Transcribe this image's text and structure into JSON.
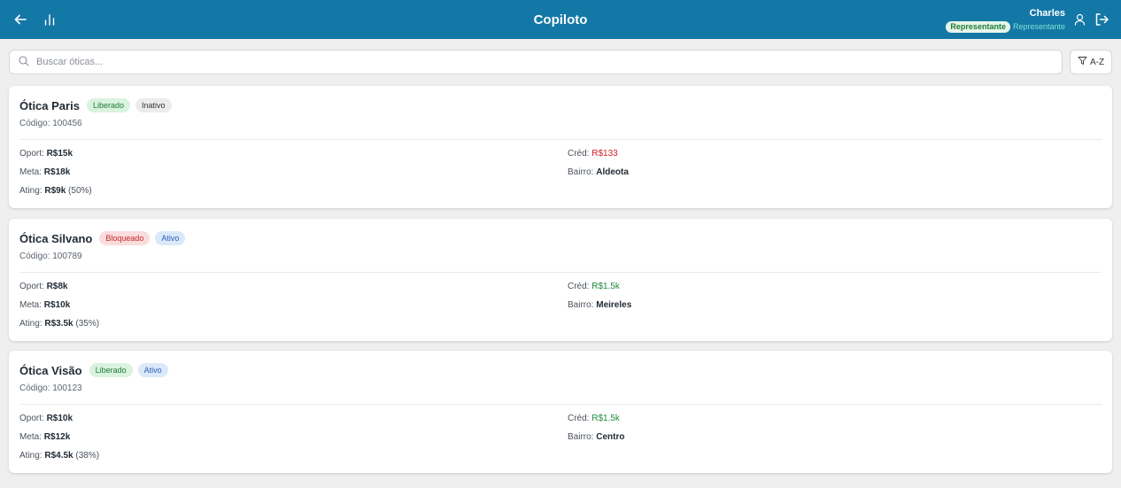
{
  "header": {
    "title": "Copiloto",
    "user_name": "Charles",
    "role_badge": "Representante",
    "role_text": "Representante"
  },
  "search": {
    "placeholder": "Buscar óticas...",
    "value": "",
    "sort_label": "A-Z"
  },
  "colors": {
    "topbar": "#1478a6",
    "negative": "#d1242a",
    "positive": "#1e8a3e"
  },
  "labels": {
    "code": "Código:",
    "oport": "Oport:",
    "meta": "Meta:",
    "ating": "Ating:",
    "cred": "Créd:",
    "bairro": "Bairro:"
  },
  "cards": [
    {
      "name": "Ótica Paris",
      "status_badge": "Liberado",
      "activity_badge": "Inativo",
      "code": "100456",
      "oport": "R$15k",
      "meta": "R$18k",
      "ating": "R$9k",
      "ating_pct": "(50%)",
      "cred": "R$133",
      "bairro": "Aldeota"
    },
    {
      "name": "Ótica Silvano",
      "status_badge": "Bloqueado",
      "activity_badge": "Ativo",
      "code": "100789",
      "oport": "R$8k",
      "meta": "R$10k",
      "ating": "R$3.5k",
      "ating_pct": "(35%)",
      "cred": "R$1.5k",
      "bairro": "Meireles"
    },
    {
      "name": "Ótica Visão",
      "status_badge": "Liberado",
      "activity_badge": "Ativo",
      "code": "100123",
      "oport": "R$10k",
      "meta": "R$12k",
      "ating": "R$4.5k",
      "ating_pct": "(38%)",
      "cred": "R$1.5k",
      "bairro": "Centro"
    }
  ]
}
